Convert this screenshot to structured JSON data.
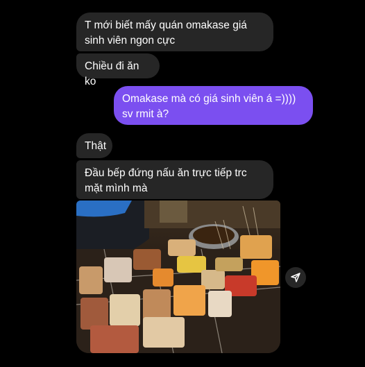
{
  "messages": [
    {
      "sender": "other",
      "text": "T mới biết mấy quán omakase giá sinh viên ngon cực"
    },
    {
      "sender": "other",
      "text": "Chiều đi ăn ko"
    },
    {
      "sender": "me",
      "text": "Omakase mà có giá sinh viên á =)))) sv rmit à?"
    },
    {
      "sender": "other",
      "text": "Thật"
    },
    {
      "sender": "other",
      "text": "Đầu bếp đứng nấu ăn trực tiếp trc mặt mình mà"
    }
  ],
  "attachment": {
    "type": "photo",
    "subject": "street-food-skewers-stall"
  },
  "colors": {
    "background": "#000000",
    "incoming": "#262626",
    "outgoing": "#7b4ff0"
  },
  "icons": {
    "share": "share-icon"
  }
}
